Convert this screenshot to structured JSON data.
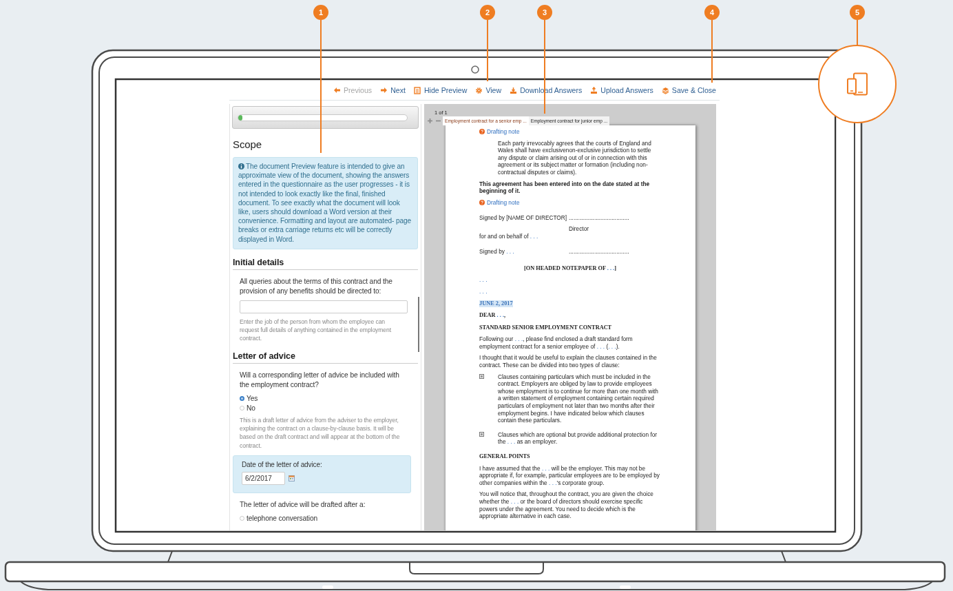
{
  "callouts": [
    {
      "number": "1"
    },
    {
      "number": "2"
    },
    {
      "number": "3"
    },
    {
      "number": "4"
    },
    {
      "number": "5"
    }
  ],
  "toolbar": [
    {
      "kind": "previous",
      "label": "Previous",
      "disabled": true
    },
    {
      "kind": "next",
      "label": "Next",
      "disabled": false
    },
    {
      "kind": "preview",
      "label": "Hide Preview",
      "disabled": false
    },
    {
      "kind": "view",
      "label": "View",
      "disabled": false
    },
    {
      "kind": "download",
      "label": "Download Answers",
      "disabled": false
    },
    {
      "kind": "upload",
      "label": "Upload Answers",
      "disabled": false
    },
    {
      "kind": "save",
      "label": "Save & Close",
      "disabled": false
    }
  ],
  "progress": {
    "level": 0.02
  },
  "scope": {
    "title": "Scope",
    "info": "The document Preview feature is intended to give an approximate view of the document, showing the answers entered in the questionnaire as the user progresses - it is not intended to look exactly like the final, finished document. To see exactly what the document will look like, users should download a Word version at their convenience. Formatting and layout are automated- page breaks or extra carriage returns etc will be correctly displayed in Word."
  },
  "sections": [
    {
      "title": "Initial details",
      "items": [
        {
          "kind": "question",
          "text": "All queries about the terms of this contract and the provision of any benefits should be directed to:"
        },
        {
          "kind": "textfield"
        },
        {
          "kind": "help",
          "text": "Enter the job of the person from whom the employee can request full details of anything contained in the employment contract."
        }
      ]
    },
    {
      "title": "Letter of advice",
      "items": [
        {
          "kind": "question",
          "text": "Will a corresponding letter of advice be included with the employment contract?"
        },
        {
          "kind": "radio",
          "label": "Yes",
          "selected": true
        },
        {
          "kind": "radio",
          "label": "No",
          "selected": false
        },
        {
          "kind": "help",
          "text": "This is a draft letter of advice from the adviser to the employer, explaining the contract on a clause-by-clause basis. It will be based on the draft contract and will appear at the bottom of the contract."
        },
        {
          "kind": "date",
          "label": "Date of the letter of advice:",
          "value": "6/2/2017"
        },
        {
          "kind": "question",
          "text": "The letter of advice will be drafted after a:"
        },
        {
          "kind": "radio",
          "label": "telephone conversation",
          "selected": false
        }
      ]
    }
  ],
  "preview": {
    "page_indicator": "1 of 1",
    "tabs": [
      {
        "label": "Employment contract for a senior emp ...",
        "selected": true
      },
      {
        "label": "Employment contract for junior emp ...",
        "selected": false
      }
    ],
    "blocks": [
      {
        "kind": "note",
        "text": [
          "Drafting note"
        ]
      },
      {
        "kind": "indent",
        "text": [
          "Each party irrevocably agrees that the courts of England and Wales shall have exclusivenon-exclusive jurisdiction to settle any dispute or claim arising out of or in connection with this agreement or its subject matter or formation (including non-contractual disputes or claims)."
        ]
      },
      {
        "kind": "strong",
        "text": [
          "This agreement has been entered into on the date stated at the beginning of it."
        ]
      },
      {
        "kind": "note",
        "text": [
          "Drafting note"
        ]
      },
      {
        "kind": "signature",
        "text": [
          "Signed by [NAME OF DIRECTOR]"
        ],
        "line": "......................................",
        "role": "Director"
      },
      {
        "kind": "para",
        "text": [
          "for and on behalf of ",
          {
            "field": ". . ."
          }
        ]
      },
      {
        "kind": "signature",
        "text": [
          "Signed by ",
          {
            "field": ". . ."
          }
        ],
        "line": "......................................"
      },
      {
        "kind": "center",
        "text": [
          "[ON HEADED NOTEPAPER OF ",
          {
            "field": ". . ."
          },
          "]"
        ]
      },
      {
        "kind": "para",
        "text": [
          {
            "field": ". . ."
          }
        ]
      },
      {
        "kind": "para",
        "text": [
          {
            "field": ". . ."
          }
        ]
      },
      {
        "kind": "date",
        "text": [
          "JUNE 2, 2017"
        ]
      },
      {
        "kind": "salutation",
        "text": [
          "DEAR ",
          {
            "field": ". . ."
          },
          ","
        ]
      },
      {
        "kind": "heading",
        "text": [
          "STANDARD SENIOR EMPLOYMENT CONTRACT"
        ]
      },
      {
        "kind": "para",
        "text": [
          "Following our ",
          {
            "field": ". . ."
          },
          ", please find enclosed a draft standard form employment contract for a senior employee of ",
          {
            "field": ". . ."
          },
          " (",
          {
            "field": ". . ."
          },
          ")."
        ]
      },
      {
        "kind": "para",
        "text": [
          "I thought that it would be useful to explain the clauses contained in the contract. These can be divided into two types of clause:"
        ]
      },
      {
        "kind": "bullet",
        "text": [
          "Clauses containing particulars which must be included in the contract. Employers are obliged by law to provide employees whose employment is to continue for more than one month with a written statement of employment containing certain required particulars of employment not later than two months after their employment begins. I have indicated below which clauses contain these particulars."
        ]
      },
      {
        "kind": "bullet",
        "text": [
          "Clauses which are optional but provide additional protection for the ",
          {
            "field": ". . ."
          },
          " as an employer."
        ]
      },
      {
        "kind": "heading",
        "text": [
          "GENERAL POINTS"
        ]
      },
      {
        "kind": "para",
        "text": [
          "I have assumed that the ",
          {
            "field": ". . ."
          },
          " will be the employer. This may not be appropriate if, for example, particular employees are to be employed by other companies within the ",
          {
            "field": ". . ."
          },
          "'s corporate group."
        ]
      },
      {
        "kind": "para",
        "text": [
          "You will notice that, throughout the contract, you are given the choice whether the ",
          {
            "field": ". . ."
          },
          " or the board of directors should exercise specific powers under the agreement. You need to decide which is the appropriate alternative in each case."
        ]
      }
    ]
  }
}
